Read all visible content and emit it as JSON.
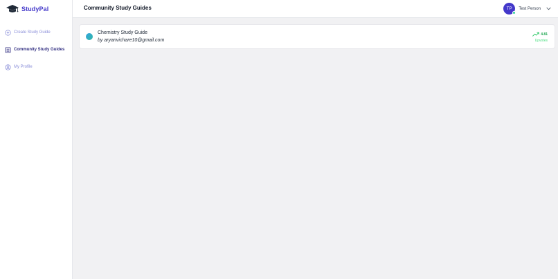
{
  "brand": {
    "name": "StudyPal",
    "icon": "graduation-cap-icon",
    "accent": "#4338ca"
  },
  "sidebar": {
    "items": [
      {
        "label": "Create Study Guide",
        "icon": "upload-cloud-icon",
        "active": false
      },
      {
        "label": "Community Study Guides",
        "icon": "book-list-icon",
        "active": true
      },
      {
        "label": "My Profile",
        "icon": "user-circle-icon",
        "active": false
      }
    ]
  },
  "header": {
    "title": "Community Study Guides",
    "user": {
      "initials": "TP",
      "name": "Test Person",
      "status": "online"
    }
  },
  "guides": [
    {
      "title": "Chemistry Study Guide",
      "author_prefix": "by",
      "author": "aryanvichare10@gmail.com",
      "votes": "4.81",
      "votes_label": "Upvotes",
      "trend_icon": "trending-up-icon"
    }
  ],
  "colors": {
    "background": "#f1f1f3",
    "nav_inactive": "#8b8fd9",
    "nav_active": "#312e81",
    "upvote": "#16a34a"
  }
}
